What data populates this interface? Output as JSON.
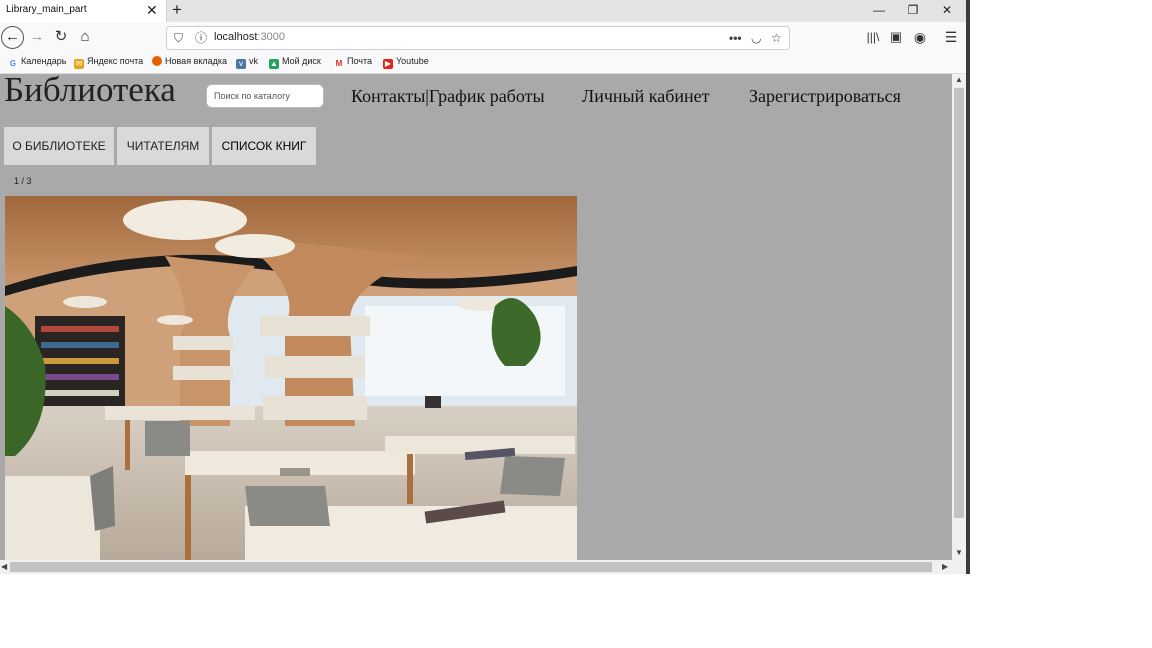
{
  "browser": {
    "tab_title": "Library_main_part",
    "tab_close": "✕",
    "new_tab": "+",
    "url_host": "localhost",
    "url_port": ":3000",
    "window": {
      "minimize": "—",
      "restore": "❐",
      "close": "✕"
    },
    "bookmarks": [
      {
        "label": "Календарь",
        "icon": "google-icon"
      },
      {
        "label": "Яндекс почта",
        "icon": "mail-icon"
      },
      {
        "label": "Новая вкладка",
        "icon": "firefox-icon"
      },
      {
        "label": "vk",
        "icon": "vk-icon"
      },
      {
        "label": "Мой диск",
        "icon": "drive-icon"
      },
      {
        "label": "Почта",
        "icon": "gmail-icon"
      },
      {
        "label": "Youtube",
        "icon": "youtube-icon"
      }
    ]
  },
  "site": {
    "title": "Библиотека",
    "search_placeholder": "Поиск по каталогу",
    "nav": {
      "contacts": "Контакты|График работы",
      "account": "Личный кабинет",
      "register": "Зарегистрироваться"
    },
    "menu": {
      "about": "О БИБЛИОТЕКЕ",
      "readers": "ЧИТАТЕЛЯМ",
      "books": "СПИСОК КНИГ"
    },
    "slide_counter": "1 / 3"
  },
  "colors": {
    "page_background": "#a9a9a9",
    "menu_button": "#d9d9d9"
  }
}
